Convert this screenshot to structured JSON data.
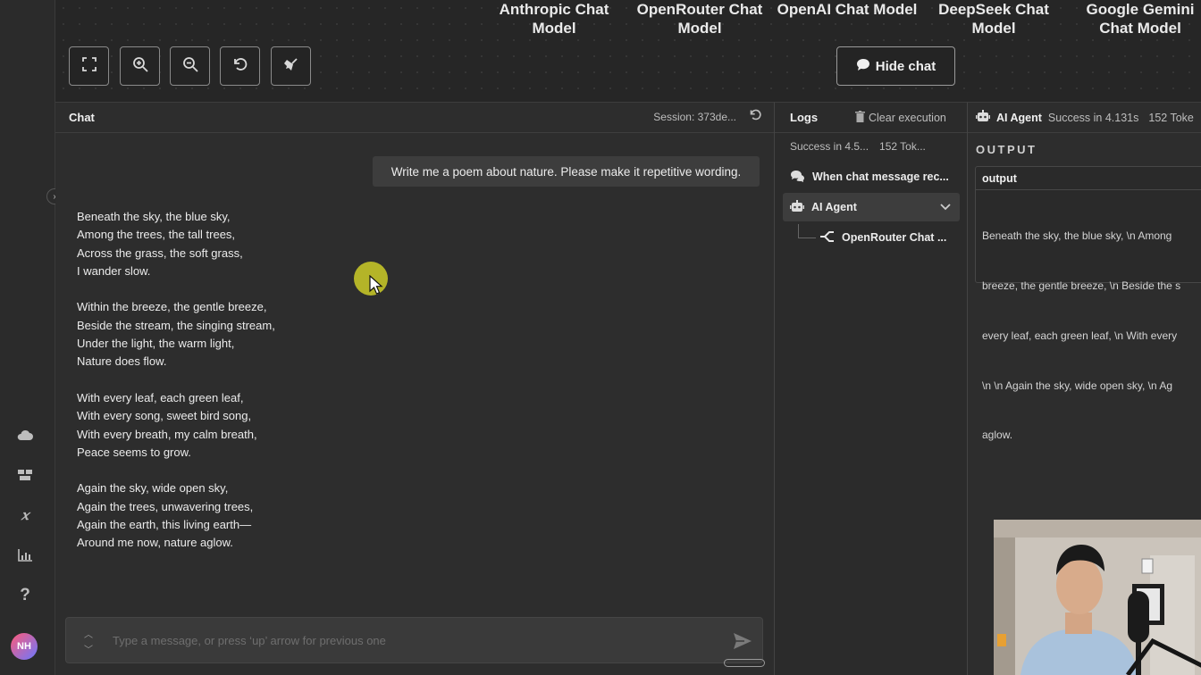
{
  "canvas": {
    "node_labels": [
      "Anthropic Chat Model",
      "OpenRouter Chat Model",
      "OpenAI Chat Model",
      "DeepSeek Chat Model",
      "Google Gemini Chat Model"
    ],
    "toolbar": [
      {
        "name": "fit-view-button",
        "icon": "fullscreen-icon"
      },
      {
        "name": "zoom-in-button",
        "icon": "zoom-in-icon"
      },
      {
        "name": "zoom-out-button",
        "icon": "zoom-out-icon"
      },
      {
        "name": "reset-zoom-button",
        "icon": "undo-icon"
      },
      {
        "name": "tidy-up-button",
        "icon": "broom-icon"
      }
    ],
    "hide_chat_label": "Hide chat"
  },
  "sidebar": {
    "icons": [
      "cloud-icon",
      "templates-icon",
      "variables-icon",
      "insights-icon",
      "help-icon"
    ],
    "avatar_initials": "NH"
  },
  "chat": {
    "title": "Chat",
    "session": "Session: 373de...",
    "user_message": "Write me a poem about nature. Please make it repetitive wording.",
    "poem": [
      [
        "Beneath the sky, the blue sky,",
        "Among the trees, the tall trees,",
        "Across the grass, the soft grass,",
        "I wander slow."
      ],
      [
        "Within the breeze, the gentle breeze,",
        "Beside the stream, the singing stream,",
        "Under the light, the warm light,",
        "Nature does flow."
      ],
      [
        "With every leaf, each green leaf,",
        "With every song, sweet bird song,",
        "With every breath, my calm breath,",
        "Peace seems to grow."
      ],
      [
        "Again the sky, wide open sky,",
        "Again the trees, unwavering trees,",
        "Again the earth, this living earth—",
        "Around me now, nature aglow."
      ]
    ],
    "input_placeholder": "Type a message, or press ‘up’ arrow for previous one"
  },
  "logs": {
    "title": "Logs",
    "clear_label": "Clear execution",
    "status": "Success in 4.5...",
    "tokens": "152 Tok...",
    "items": [
      {
        "label": "When chat message rec...",
        "icon": "chat-bubbles-icon"
      },
      {
        "label": "AI Agent",
        "icon": "robot-icon"
      },
      {
        "label": "OpenRouter Chat ...",
        "icon": "openrouter-icon"
      }
    ]
  },
  "output": {
    "agent": "AI Agent",
    "status": "Success in 4.131s",
    "tokens": "152 Toke",
    "section_label": "OUTPUT",
    "field_label": "output",
    "lines": [
      "Beneath the sky, the blue sky, \\n Among",
      "breeze, the gentle breeze, \\n Beside the s",
      "every leaf, each green leaf, \\n With every",
      "\\n \\n Again the sky, wide open sky, \\n Ag",
      "aglow."
    ]
  }
}
